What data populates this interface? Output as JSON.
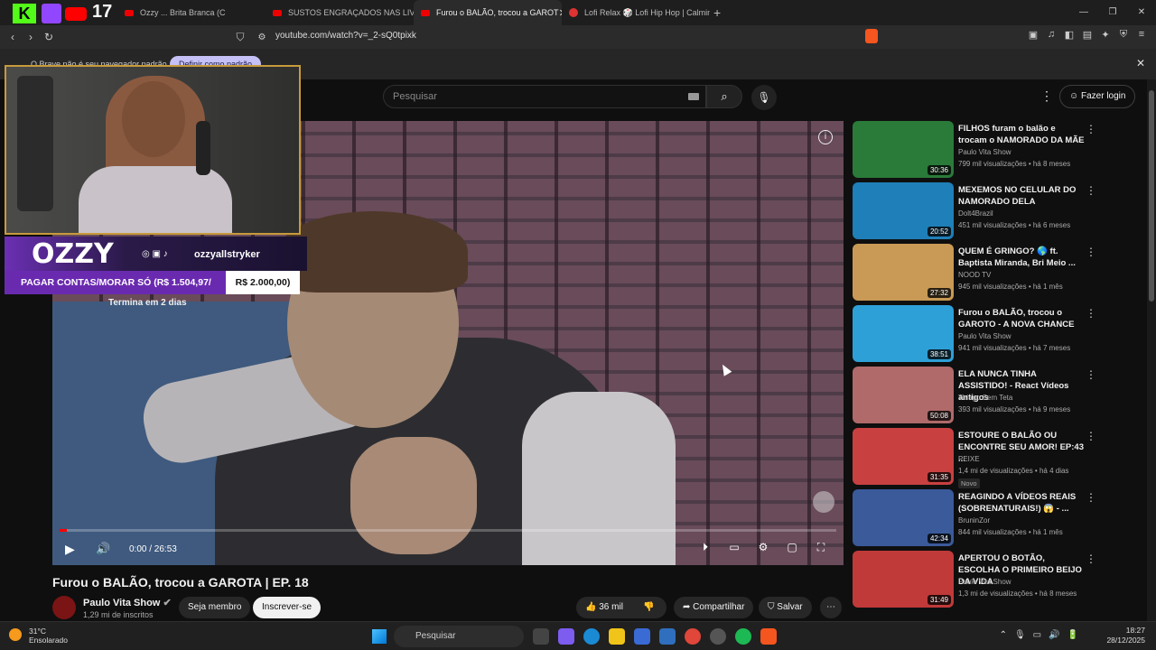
{
  "browser": {
    "tabs": [
      {
        "label": "Ozzy ... Brita Branca (C"
      },
      {
        "label": "SUSTOS ENGRAÇADOS NAS LIVES #"
      },
      {
        "label": "Furou o BALÃO, trocou a GAROT"
      },
      {
        "label": "Lofi Relax 🎲 Lofi Hip Hop | Calming"
      }
    ],
    "active_tab": 2,
    "url": "youtube.com/watch?v=_2-sQ0tpixk",
    "infobar_message": "O Brave não é seu navegador padrão",
    "infobar_button": "Definir como padrão"
  },
  "youtube": {
    "search_placeholder": "Pesquisar",
    "login_label": "Fazer login",
    "player": {
      "time": "0:00 / 26:53",
      "progress": 0.0
    },
    "video_title": "Furou o BALÃO, trocou a GAROTA | EP. 18",
    "channel_name": "Paulo Vita Show",
    "subscribers": "1,29 mi de inscritos",
    "member_label": "Seja membro",
    "subscribe_label": "Inscrever-se",
    "likes": "36 mil",
    "share_label": "Compartilhar",
    "save_label": "Salvar",
    "recommendations": [
      {
        "title": "FILHOS furam o balão e trocam o NAMORADO DA MÃE",
        "channel": "Paulo Vita Show",
        "meta": "799 mil visualizações • há 8 meses",
        "duration": "30:36",
        "color": "#2a7a3a"
      },
      {
        "title": "MEXEMOS NO CELULAR DO NAMORADO DELA",
        "channel": "Dolt4Brazil",
        "meta": "451 mil visualizações • há 6 meses",
        "duration": "20:52",
        "color": "#1f7fb8"
      },
      {
        "title": "QUEM É GRINGO? 🌎 ft. Baptista Miranda, Bri Meio ...",
        "channel": "NOOD TV",
        "meta": "945 mil visualizações • há 1 mês",
        "duration": "27:32",
        "color": "#c89a55"
      },
      {
        "title": "Furou o BALÃO, trocou o GAROTO - A NOVA CHANCE",
        "channel": "Paulo Vita Show",
        "meta": "941 mil visualizações • há 7 meses",
        "duration": "38:51",
        "color": "#2ea0d8"
      },
      {
        "title": "ELA NUNCA TINHA ASSISTIDO! - React Vídeos antigos",
        "channel": "Thiago Sem Teta",
        "meta": "393 mil visualizações • há 9 meses",
        "duration": "50:08",
        "color": "#b06a6a"
      },
      {
        "title": "ESTOURE O BALÃO OU ENCONTRE SEU AMOR! EP:43 ...",
        "channel": "PEIXE",
        "meta": "1,4 mi de visualizações • há 4 dias",
        "duration": "31:35",
        "color": "#c84040",
        "badge": "Novo"
      },
      {
        "title": "REAGINDO A VÍDEOS REAIS (SOBRENATURAIS!) 😱 - ...",
        "channel": "BruninZor",
        "meta": "844 mil visualizações • há 1 mês",
        "duration": "42:34",
        "color": "#3a5a9a"
      },
      {
        "title": "APERTOU O BOTÃO, ESCOLHA O PRIMEIRO BEIJO DA VIDA",
        "channel": "Paulo Vita Show",
        "meta": "1,3 mi de visualizações • há 8 meses",
        "duration": "31:49",
        "color": "#c03a3a"
      }
    ]
  },
  "stream_overlay": {
    "counter": "17",
    "brand": "OZZY",
    "handle": "ozzyallstryker",
    "goal_text": "PAGAR CONTAS/MORAR SÓ (R$ 1.504,97/",
    "goal_target": "R$ 2.000,00)",
    "goal_end": "Termina em 2 dias"
  },
  "taskbar": {
    "temperature": "31°C",
    "weather": "Ensolarado",
    "search_label": "Pesquisar",
    "time": "18:27",
    "date": "28/12/2025"
  },
  "colors": {
    "accent": "#ff0000",
    "overlay_purple": "#6a2ab0",
    "brave": "#f5551e"
  }
}
